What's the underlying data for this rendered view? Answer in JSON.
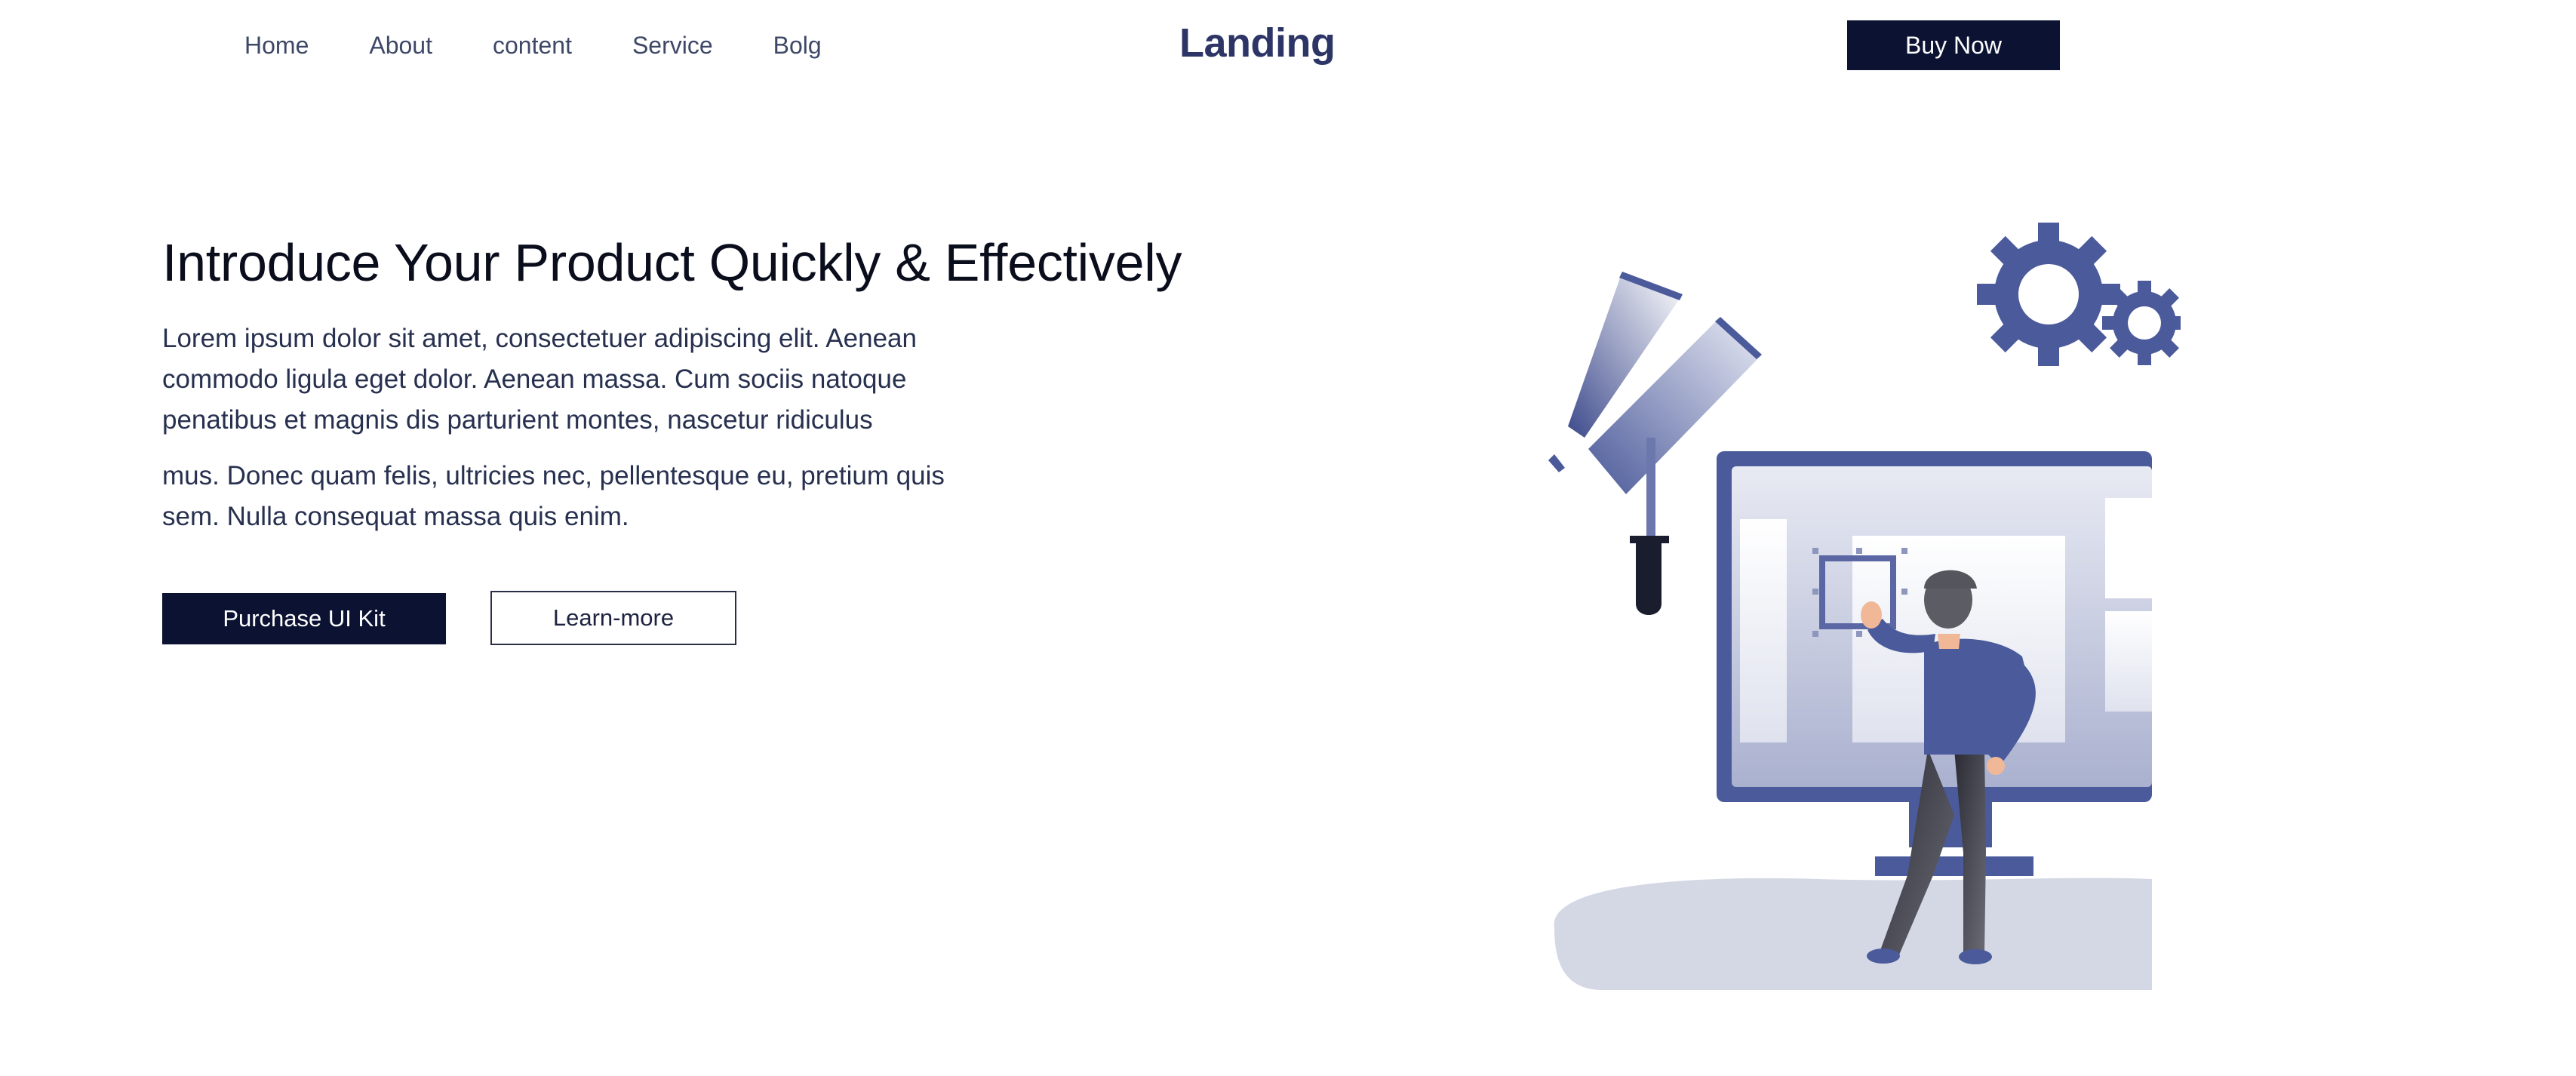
{
  "nav": {
    "links": [
      {
        "label": "Home"
      },
      {
        "label": "About"
      },
      {
        "label": "content"
      },
      {
        "label": "Service"
      },
      {
        "label": "Bolg"
      }
    ],
    "logo": "Landing",
    "cta_label": "Buy Now"
  },
  "hero": {
    "title": "Introduce Your Product Quickly & Effectively",
    "paragraph_1": "Lorem ipsum dolor sit amet, consectetuer adipiscing elit. Aenean commodo ligula eget dolor. Aenean massa. Cum sociis natoque penatibus et magnis dis parturient montes, nascetur ridiculus",
    "paragraph_2": "mus. Donec quam felis, ultricies nec, pellentesque eu, pretium quis sem. Nulla consequat massa quis enim.",
    "primary_button": "Purchase UI Kit",
    "secondary_button": "Learn-more"
  },
  "colors": {
    "dark_navy": "#0b1232",
    "logo_blue": "#2c3566",
    "illustration_blue": "#4b5a9a",
    "illustration_light": "#c5cadf"
  },
  "illustration": {
    "icons": [
      "telescope-icon",
      "gear-icon",
      "monitor-icon",
      "person-figure"
    ]
  }
}
